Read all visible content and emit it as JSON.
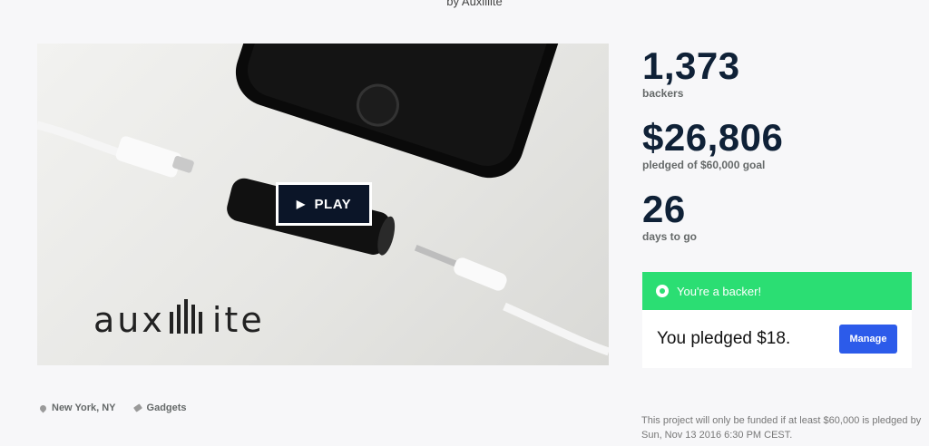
{
  "header": {
    "byline": "by Auxillite"
  },
  "video": {
    "logo_text": "aux",
    "logo_suffix": "ite",
    "play_label": "PLAY"
  },
  "stats": {
    "backers_count": "1,373",
    "backers_label": "backers",
    "pledged_amount": "$26,806",
    "pledged_label": "pledged of $60,000 goal",
    "days_count": "26",
    "days_label": "days to go"
  },
  "backer_status": {
    "banner_text": "You're a backer!",
    "pledge_text": "You pledged $18.",
    "manage_label": "Manage",
    "banner_color": "#2bde73",
    "button_color": "#2c5bea"
  },
  "meta": {
    "location": "New York, NY",
    "category": "Gadgets"
  },
  "funding_note": "This project will only be funded if at least $60,000 is pledged by Sun, Nov 13 2016 6:30 PM CEST."
}
